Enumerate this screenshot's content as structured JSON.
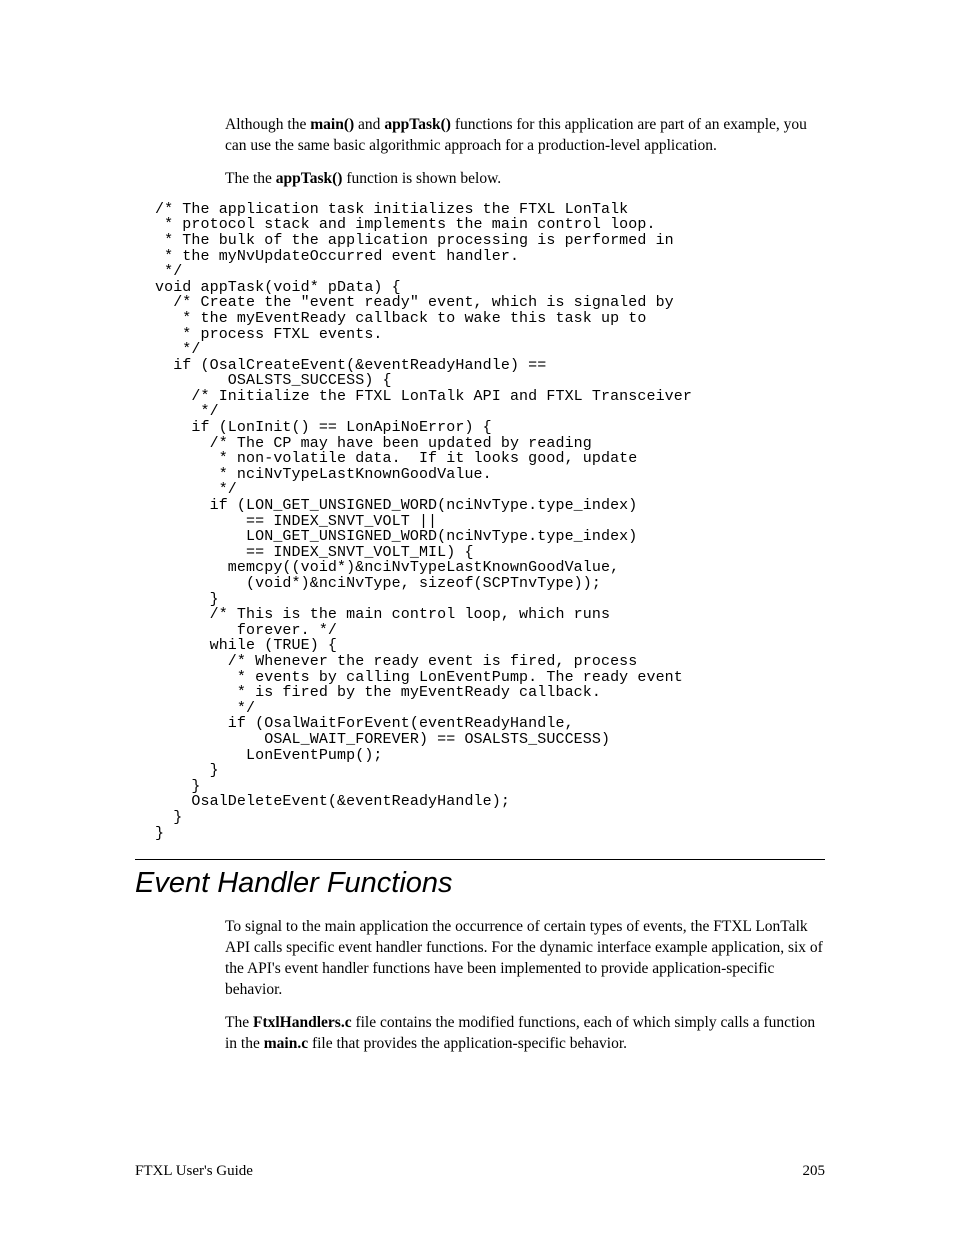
{
  "intro": {
    "p1_a": "Although the ",
    "p1_b": " and ",
    "p1_c": " functions for this application are part of an example, you can use the same basic algorithmic approach for a production-level application.",
    "main_fn": "main()",
    "apptask_fn": "appTask()",
    "p2_a": "The the ",
    "p2_b": " function is shown below."
  },
  "code": "/* The application task initializes the FTXL LonTalk \n * protocol stack and implements the main control loop. \n * The bulk of the application processing is performed in \n * the myNvUpdateOccurred event handler.  \n */ \nvoid appTask(void* pData) { \n  /* Create the \"event ready\" event, which is signaled by \n   * the myEventReady callback to wake this task up to \n   * process FTXL events. \n   */ \n  if (OsalCreateEvent(&eventReadyHandle) ==  \n        OSALSTS_SUCCESS) { \n    /* Initialize the FTXL LonTalk API and FTXL Transceiver \n     */ \n    if (LonInit() == LonApiNoError) { \n      /* The CP may have been updated by reading  \n       * non-volatile data.  If it looks good, update  \n       * nciNvTypeLastKnownGoodValue. \n       */ \n      if (LON_GET_UNSIGNED_WORD(nciNvType.type_index)  \n          == INDEX_SNVT_VOLT || \n          LON_GET_UNSIGNED_WORD(nciNvType.type_index)  \n          == INDEX_SNVT_VOLT_MIL) { \n        memcpy((void*)&nciNvTypeLastKnownGoodValue,  \n          (void*)&nciNvType, sizeof(SCPTnvType)); \n      } \n      /* This is the main control loop, which runs  \n         forever. */ \n      while (TRUE) { \n        /* Whenever the ready event is fired, process  \n         * events by calling LonEventPump. The ready event \n         * is fired by the myEventReady callback.  \n         */ \n        if (OsalWaitForEvent(eventReadyHandle,  \n            OSAL_WAIT_FOREVER) == OSALSTS_SUCCESS) \n          LonEventPump(); \n      } \n    } \n    OsalDeleteEvent(&eventReadyHandle); \n  } \n} ",
  "section": {
    "heading": "Event Handler Functions",
    "p1": "To signal to the main application the occurrence of certain types of events, the FTXL LonTalk API calls specific event handler functions.  For the dynamic interface example application, six of the API's event handler functions have been implemented to provide application-specific behavior.",
    "p2_a": "The ",
    "ftxl": "FtxlHandlers.c",
    "p2_b": " file contains the modified functions, each of which simply calls a function in the ",
    "mainc": "main.c",
    "p2_c": " file that provides the application-specific behavior."
  },
  "footer": {
    "left": "FTXL User's Guide",
    "right": "205"
  }
}
